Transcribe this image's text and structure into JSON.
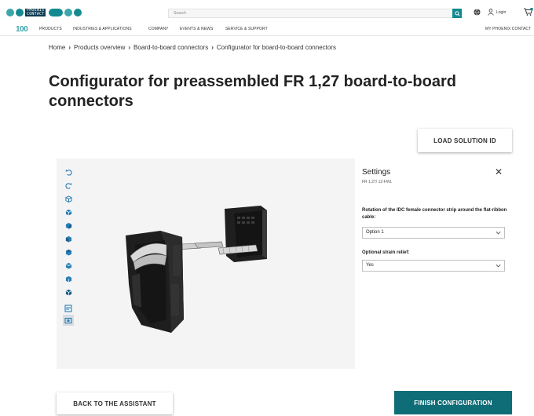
{
  "header": {
    "brand_line1": "PHOENIX",
    "brand_line2": "CONTACT",
    "search_placeholder": "Search",
    "login_label": "Login",
    "badge_color": "#128a8f",
    "brand_color": "#0e3b53"
  },
  "nav": {
    "logo_100": "100",
    "items": [
      "PRODUCTS",
      "INDUSTRIES & APPLICATIONS",
      "COMPANY",
      "EVENTS & NEWS",
      "SERVICE & SUPPORT"
    ],
    "my_account": "MY PHOENIX CONTACT"
  },
  "breadcrumb": [
    "Home",
    "Products overview",
    "Board-to-board connectors",
    "Configurator for board-to-board connectors"
  ],
  "page": {
    "title": "Configurator for preassembled FR 1,27 board-to-board connectors",
    "load_button": "LOAD SOLUTION ID"
  },
  "toolbar": {
    "tools": [
      "undo-icon",
      "redo-icon",
      "view-iso-icon",
      "view-front-icon",
      "view-back-icon",
      "view-left-icon",
      "view-right-icon",
      "view-top-icon",
      "view-bottom-icon",
      "dimensions-icon",
      "screenshot-icon"
    ]
  },
  "settings": {
    "title": "Settings",
    "product_code": "FR 1,27/ 12-FWL",
    "close_icon": "close-icon",
    "rotation_label": "Rotation of the IDC female connector strip around the flat-ribbon cable:",
    "rotation_value": "Option 1",
    "strain_label": "Optional strain relief:",
    "strain_value": "Yes"
  },
  "footer": {
    "back_button": "BACK TO THE ASSISTANT",
    "finish_button": "FINISH CONFIGURATION",
    "finish_color": "#0f6d78"
  }
}
